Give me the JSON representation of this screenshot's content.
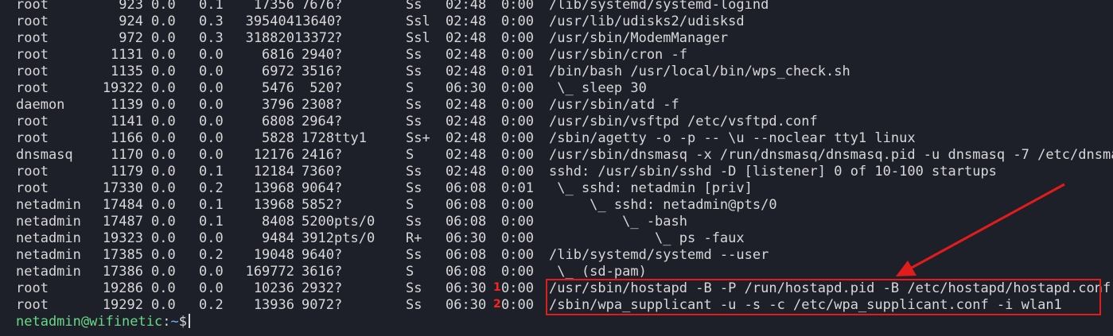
{
  "processes": [
    {
      "user": "root",
      "pid": "923",
      "cpu": "0.0",
      "mem": "0.1",
      "vsz": "17356",
      "rss": "7676",
      "tty": "?",
      "stat": "Ss",
      "start": "02:48",
      "time": "0:00",
      "cmd": "/lib/systemd/systemd-logind"
    },
    {
      "user": "root",
      "pid": "924",
      "cpu": "0.0",
      "mem": "0.3",
      "vsz": "395404",
      "rss": "13640",
      "tty": "?",
      "stat": "Ssl",
      "start": "02:48",
      "time": "0:00",
      "cmd": "/usr/lib/udisks2/udisksd"
    },
    {
      "user": "root",
      "pid": "972",
      "cpu": "0.0",
      "mem": "0.3",
      "vsz": "318820",
      "rss": "13372",
      "tty": "?",
      "stat": "Ssl",
      "start": "02:48",
      "time": "0:00",
      "cmd": "/usr/sbin/ModemManager"
    },
    {
      "user": "root",
      "pid": "1131",
      "cpu": "0.0",
      "mem": "0.0",
      "vsz": "6816",
      "rss": "2940",
      "tty": "?",
      "stat": "Ss",
      "start": "02:48",
      "time": "0:00",
      "cmd": "/usr/sbin/cron -f"
    },
    {
      "user": "root",
      "pid": "1135",
      "cpu": "0.0",
      "mem": "0.0",
      "vsz": "6972",
      "rss": "3516",
      "tty": "?",
      "stat": "Ss",
      "start": "02:48",
      "time": "0:01",
      "cmd": "/bin/bash /usr/local/bin/wps_check.sh"
    },
    {
      "user": "root",
      "pid": "19322",
      "cpu": "0.0",
      "mem": "0.0",
      "vsz": "5476",
      "rss": "520",
      "tty": "?",
      "stat": "S",
      "start": "06:30",
      "time": "0:00",
      "cmd": " \\_ sleep 30"
    },
    {
      "user": "daemon",
      "pid": "1139",
      "cpu": "0.0",
      "mem": "0.0",
      "vsz": "3796",
      "rss": "2308",
      "tty": "?",
      "stat": "Ss",
      "start": "02:48",
      "time": "0:00",
      "cmd": "/usr/sbin/atd -f"
    },
    {
      "user": "root",
      "pid": "1141",
      "cpu": "0.0",
      "mem": "0.0",
      "vsz": "6808",
      "rss": "2964",
      "tty": "?",
      "stat": "Ss",
      "start": "02:48",
      "time": "0:00",
      "cmd": "/usr/sbin/vsftpd /etc/vsftpd.conf"
    },
    {
      "user": "root",
      "pid": "1166",
      "cpu": "0.0",
      "mem": "0.0",
      "vsz": "5828",
      "rss": "1728",
      "tty": "tty1",
      "stat": "Ss+",
      "start": "02:48",
      "time": "0:00",
      "cmd": "/sbin/agetty -o -p -- \\u --noclear tty1 linux"
    },
    {
      "user": "dnsmasq",
      "pid": "1170",
      "cpu": "0.0",
      "mem": "0.0",
      "vsz": "12176",
      "rss": "2416",
      "tty": "?",
      "stat": "S",
      "start": "02:48",
      "time": "0:00",
      "cmd": "/usr/sbin/dnsmasq -x /run/dnsmasq/dnsmasq.pid -u dnsmasq -7 /etc/dnsmas"
    },
    {
      "user": "root",
      "pid": "1179",
      "cpu": "0.0",
      "mem": "0.1",
      "vsz": "12184",
      "rss": "7360",
      "tty": "?",
      "stat": "Ss",
      "start": "02:48",
      "time": "0:00",
      "cmd": "sshd: /usr/sbin/sshd -D [listener] 0 of 10-100 startups"
    },
    {
      "user": "root",
      "pid": "17330",
      "cpu": "0.0",
      "mem": "0.2",
      "vsz": "13968",
      "rss": "9064",
      "tty": "?",
      "stat": "Ss",
      "start": "06:08",
      "time": "0:01",
      "cmd": " \\_ sshd: netadmin [priv]"
    },
    {
      "user": "netadmin",
      "pid": "17484",
      "cpu": "0.0",
      "mem": "0.1",
      "vsz": "13968",
      "rss": "5852",
      "tty": "?",
      "stat": "S",
      "start": "06:08",
      "time": "0:00",
      "cmd": "     \\_ sshd: netadmin@pts/0"
    },
    {
      "user": "netadmin",
      "pid": "17487",
      "cpu": "0.0",
      "mem": "0.1",
      "vsz": "8408",
      "rss": "5200",
      "tty": "pts/0",
      "stat": "Ss",
      "start": "06:08",
      "time": "0:00",
      "cmd": "         \\_ -bash"
    },
    {
      "user": "netadmin",
      "pid": "19323",
      "cpu": "0.0",
      "mem": "0.0",
      "vsz": "9484",
      "rss": "3912",
      "tty": "pts/0",
      "stat": "R+",
      "start": "06:30",
      "time": "0:00",
      "cmd": "             \\_ ps -faux"
    },
    {
      "user": "netadmin",
      "pid": "17385",
      "cpu": "0.0",
      "mem": "0.2",
      "vsz": "19048",
      "rss": "9640",
      "tty": "?",
      "stat": "Ss",
      "start": "06:08",
      "time": "0:00",
      "cmd": "/lib/systemd/systemd --user"
    },
    {
      "user": "netadmin",
      "pid": "17386",
      "cpu": "0.0",
      "mem": "0.0",
      "vsz": "169772",
      "rss": "3616",
      "tty": "?",
      "stat": "S",
      "start": "06:08",
      "time": "0:00",
      "cmd": " \\_ (sd-pam)"
    },
    {
      "user": "root",
      "pid": "19286",
      "cpu": "0.0",
      "mem": "0.0",
      "vsz": "10236",
      "rss": "2932",
      "tty": "?",
      "stat": "Ss",
      "start": "06:30",
      "time": "0:00",
      "cmd": "/usr/sbin/hostapd -B -P /run/hostapd.pid -B /etc/hostapd/hostapd.conf"
    },
    {
      "user": "root",
      "pid": "19292",
      "cpu": "0.0",
      "mem": "0.2",
      "vsz": "13936",
      "rss": "9072",
      "tty": "?",
      "stat": "Ss",
      "start": "06:30",
      "time": "0:00",
      "cmd": "/sbin/wpa_supplicant -u -s -c /etc/wpa_supplicant.conf -i wlan1"
    }
  ],
  "prompt": {
    "user_host": "netadmin@wifinetic",
    "separator": ":",
    "path": "~",
    "symbol": "$"
  },
  "annotations": {
    "marker_1": "1",
    "marker_2": "2",
    "color": "#e21b1b"
  },
  "colors": {
    "background": "#1e2029",
    "text": "#d8d8d8",
    "prompt_user": "#66d987",
    "prompt_path": "#6fb3ff"
  }
}
